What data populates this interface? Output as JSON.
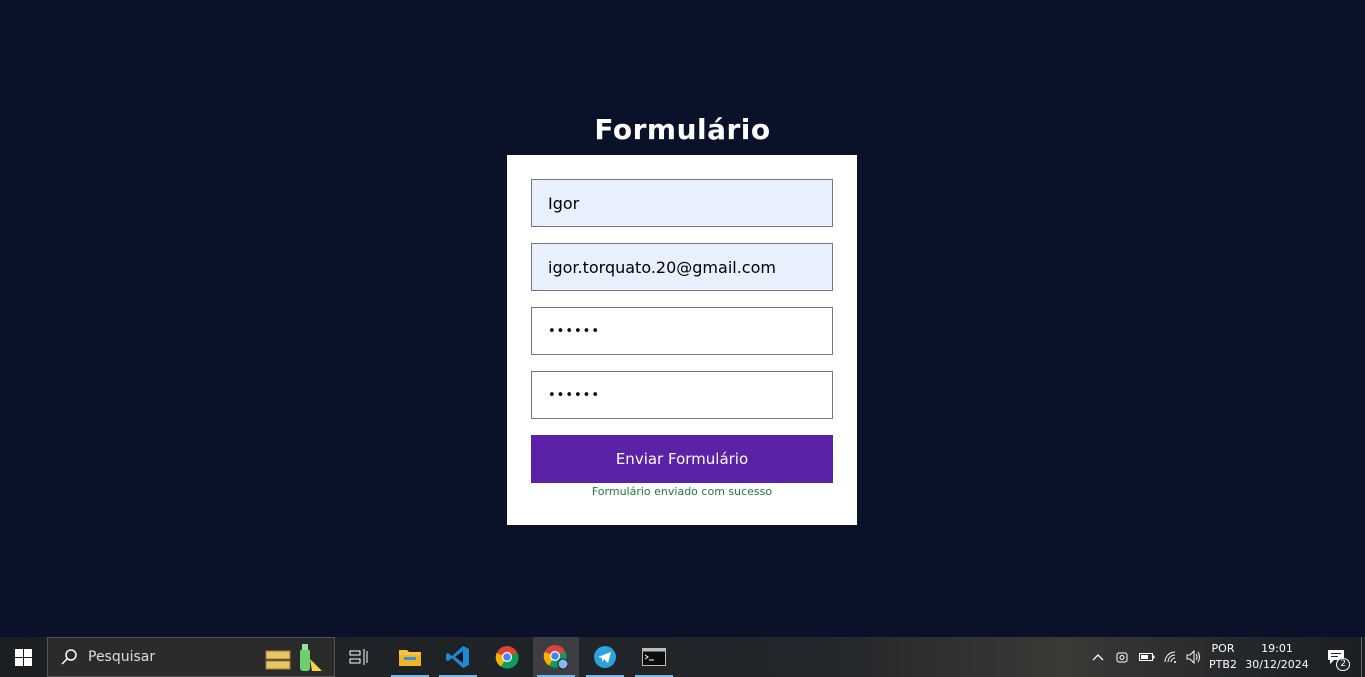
{
  "form": {
    "title": "Formulário",
    "name_value": "Igor",
    "email_value": "igor.torquato.20@gmail.com",
    "password_value": "••••••",
    "confirm_password_value": "••••••",
    "submit_label": "Enviar Formulário",
    "success_message": "Formulário enviado com sucesso"
  },
  "colors": {
    "background": "#0a1229",
    "button": "#5b21a6",
    "success": "#1d7a3a"
  },
  "taskbar": {
    "search_placeholder": "Pesquisar",
    "language_top": "POR",
    "language_bottom": "PTB2",
    "time": "19:01",
    "date": "30/12/2024",
    "notification_count": "2",
    "apps": [
      "file-explorer-icon",
      "vscode-icon",
      "chrome-icon",
      "chrome-profile-icon",
      "telegram-icon",
      "terminal-icon"
    ]
  }
}
